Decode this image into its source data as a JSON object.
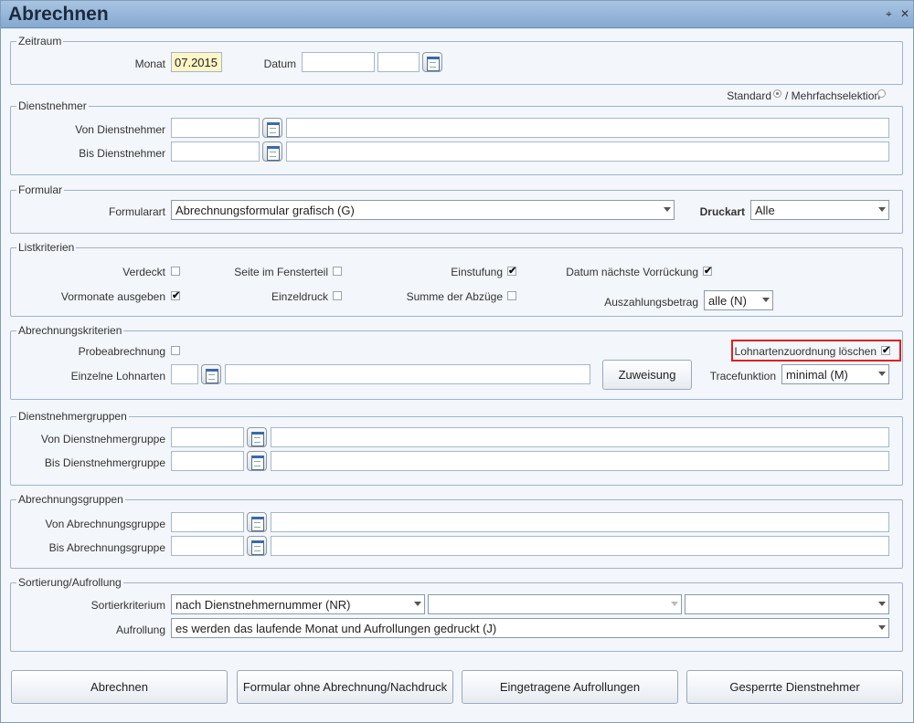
{
  "window": {
    "title": "Abrechnen",
    "pin_glyph": "⌖",
    "close_glyph": "✕"
  },
  "zeitraum": {
    "legend": "Zeitraum",
    "monat_label": "Monat",
    "monat_value": "07.2015",
    "datum_label": "Datum",
    "datum_value1": "",
    "datum_value2": ""
  },
  "mode": {
    "standard_label": "Standard",
    "mehrfach_label": "/ Mehrfachselektion",
    "selected": "standard"
  },
  "dienstnehmer": {
    "legend": "Dienstnehmer",
    "von_label": "Von Dienstnehmer",
    "von_code": "",
    "von_name": "",
    "bis_label": "Bis Dienstnehmer",
    "bis_code": "",
    "bis_name": ""
  },
  "formular": {
    "legend": "Formular",
    "art_label": "Formularart",
    "art_value": "Abrechnungsformular grafisch (G)",
    "druckart_label": "Druckart",
    "druckart_value": "Alle"
  },
  "listkriterien": {
    "legend": "Listkriterien",
    "verdeckt": {
      "label": "Verdeckt",
      "checked": false
    },
    "seite_fensterteil": {
      "label": "Seite im Fensterteil",
      "checked": false
    },
    "einstufung": {
      "label": "Einstufung",
      "checked": true
    },
    "datum_vorrueckung": {
      "label": "Datum nächste Vorrückung",
      "checked": true
    },
    "vormonate": {
      "label": "Vormonate ausgeben",
      "checked": true
    },
    "einzeldruck": {
      "label": "Einzeldruck",
      "checked": false
    },
    "summe_abzuege": {
      "label": "Summe der Abzüge",
      "checked": false
    },
    "auszahlung_label": "Auszahlungsbetrag",
    "auszahlung_value": "alle (N)"
  },
  "abrechnungskriterien": {
    "legend": "Abrechnungskriterien",
    "probe": {
      "label": "Probeabrechnung",
      "checked": false
    },
    "lohnart_loeschen": {
      "label": "Lohnartenzuordnung löschen",
      "checked": true
    },
    "einzelne_label": "Einzelne Lohnarten",
    "einzelne_code": "",
    "einzelne_text": "",
    "zuweisung_button": "Zuweisung",
    "trace_label": "Tracefunktion",
    "trace_value": "minimal (M)"
  },
  "dn_gruppen": {
    "legend": "Dienstnehmergruppen",
    "von_label": "Von Dienstnehmergruppe",
    "von_code": "",
    "von_name": "",
    "bis_label": "Bis Dienstnehmergruppe",
    "bis_code": "",
    "bis_name": ""
  },
  "abr_gruppen": {
    "legend": "Abrechnungsgruppen",
    "von_label": "Von Abrechnungsgruppe",
    "von_code": "",
    "von_name": "",
    "bis_label": "Bis Abrechnungsgruppe",
    "bis_code": "",
    "bis_name": ""
  },
  "sortierung": {
    "legend": "Sortierung/Aufrollung",
    "kriterium_label": "Sortierkriterium",
    "kriterium1": "nach Dienstnehmernummer (NR)",
    "kriterium2": "",
    "kriterium3": "",
    "aufrollung_label": "Aufrollung",
    "aufrollung_value": "es werden das laufende Monat und Aufrollungen gedruckt (J)"
  },
  "buttons": {
    "abrechnen": "Abrechnen",
    "formular_ohne": "Formular ohne Abrechnung/Nachdruck",
    "eingetragene": "Eingetragene Aufrollungen",
    "gesperrte": "Gesperrte Dienstnehmer"
  },
  "colors": {
    "highlight": "#e02020",
    "title_bar": "#85a9d1",
    "monat_bg": "#fff6c8"
  },
  "icons": {
    "calendar": "calendar-icon",
    "close": "close-icon",
    "pin": "pin-icon"
  }
}
